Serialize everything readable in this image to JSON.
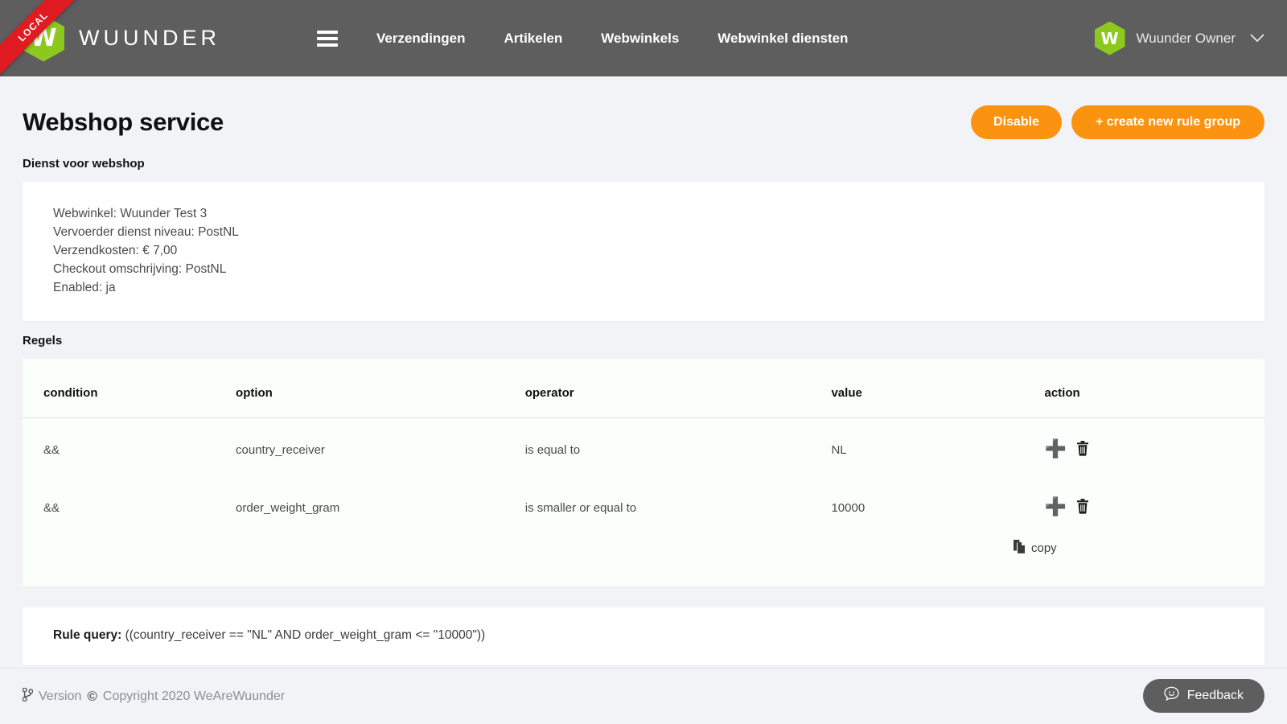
{
  "topbar": {
    "ribbon_label": "LOCAL",
    "logo_letter": "W",
    "brand_name": "WUUNDER",
    "menu_icon": "hamburger-icon",
    "nav_links": [
      {
        "label": "Verzendingen"
      },
      {
        "label": "Artikelen"
      },
      {
        "label": "Webwinkels"
      },
      {
        "label": "Webwinkel diensten"
      }
    ],
    "user": {
      "avatar_letter": "W",
      "name": "Wuunder Owner",
      "chevron": "⌄"
    },
    "background_color": "#5e5e5e",
    "brand_green": "#8dc81e",
    "ribbon_red": "#e01b22"
  },
  "page": {
    "title": "Webshop service",
    "actions": {
      "disable_label": "Disable",
      "create_rule_group_label": "+ create new rule group",
      "accent_color": "#fb9310"
    },
    "service_section": {
      "label": "Dienst voor webshop",
      "lines": [
        "Webwinkel: Wuunder Test 3",
        "Vervoerder dienst niveau: PostNL",
        "Verzendkosten: € 7,00",
        "Checkout omschrijving: PostNL",
        "Enabled: ja"
      ]
    },
    "rules_section": {
      "label": "Regels",
      "columns": [
        "condition",
        "option",
        "operator",
        "value",
        "action"
      ],
      "rows": [
        {
          "condition": "&&",
          "option": "country_receiver",
          "operator": "is equal to",
          "value": "NL"
        },
        {
          "condition": "&&",
          "option": "order_weight_gram",
          "operator": "is smaller or equal to",
          "value": "10000"
        }
      ],
      "copy_label": "copy",
      "add_icon": "plus-icon",
      "delete_icon": "trash-icon",
      "copy_icon": "copy-icon"
    },
    "rule_query": {
      "label": "Rule query:",
      "value": "((country_receiver == \"NL\" AND order_weight_gram <= \"10000\"))"
    }
  },
  "footer": {
    "version_icon": "code-branch-icon",
    "version_label": "Version",
    "copyright_mark": "©",
    "copyright_text": "Copyright 2020 WeAreWuunder",
    "feedback_label": "Feedback",
    "feedback_icon": "comment-smile-icon"
  }
}
